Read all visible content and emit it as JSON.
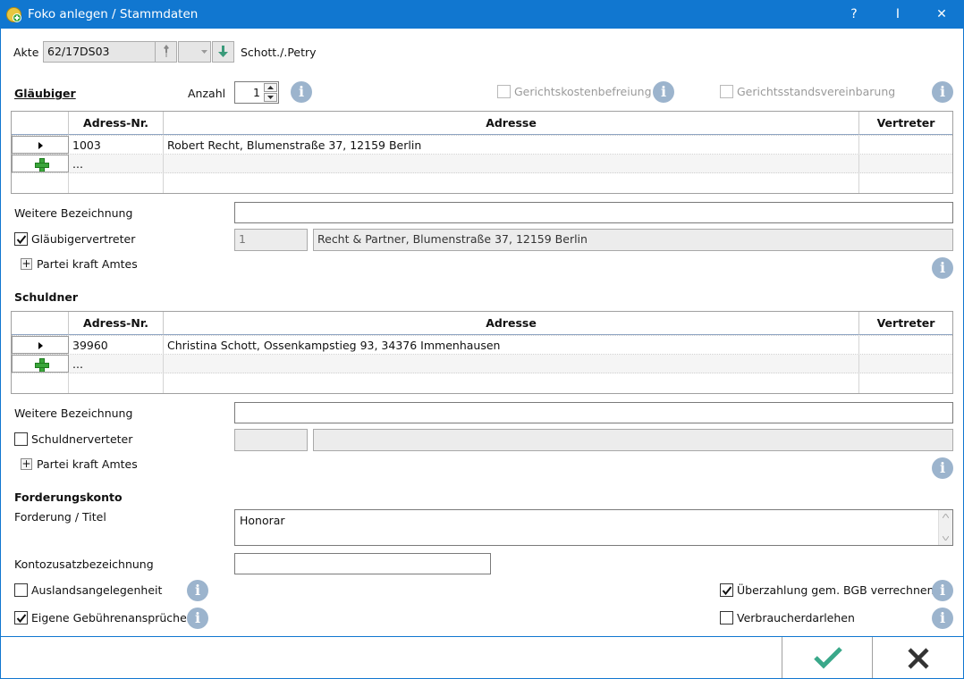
{
  "window": {
    "title": "Foko anlegen / Stammdaten",
    "help_label": "?",
    "pin_label": "I",
    "close_label": "✕"
  },
  "akte": {
    "label": "Akte",
    "value": "62/17DS03",
    "name": "Schott./.Petry"
  },
  "glaeubiger": {
    "title": "Gläubiger",
    "anzahl_label": "Anzahl",
    "anzahl_value": "1",
    "gerichtskosten_label": "Gerichtskostenbefreiung",
    "gerichtsstand_label": "Gerichtsstandsvereinbarung",
    "columns": [
      "Adress-Nr.",
      "Adresse",
      "Vertreter"
    ],
    "rows": [
      {
        "nr": "1003",
        "adresse": "Robert Recht,  Blumenstraße 37,  12159 Berlin",
        "vertreter": ""
      }
    ],
    "new_row_placeholder": "...",
    "weitere_label": "Weitere Bezeichnung",
    "weitere_value": "",
    "vertreter_label": "Gläubigervertreter",
    "vertreter_checked": true,
    "vertreter_nr": "1",
    "vertreter_adresse": "Recht & Partner,  Blumenstraße 37,  12159 Berlin",
    "partei_label": "Partei kraft Amtes"
  },
  "schuldner": {
    "title": "Schuldner",
    "columns": [
      "Adress-Nr.",
      "Adresse",
      "Vertreter"
    ],
    "rows": [
      {
        "nr": "39960",
        "adresse": "Christina Schott,  Ossenkampstieg 93,  34376 Immenhausen",
        "vertreter": ""
      }
    ],
    "new_row_placeholder": "...",
    "weitere_label": "Weitere Bezeichnung",
    "weitere_value": "",
    "vertreter_label": "Schuldnerverteter",
    "vertreter_checked": false,
    "vertreter_nr": "",
    "vertreter_adresse": "",
    "partei_label": "Partei kraft Amtes"
  },
  "forderung": {
    "title": "Forderungskonto",
    "titel_label": "Forderung / Titel",
    "titel_value": "Honorar",
    "konto_label": "Kontozusatzbezeichnung",
    "konto_value": "",
    "ausland_label": "Auslandsangelegenheit",
    "ausland_checked": false,
    "eigene_label": "Eigene Gebührenansprüche",
    "eigene_checked": true,
    "ueberzahlung_label": "Überzahlung gem. BGB verrechnen",
    "ueberzahlung_checked": true,
    "verbraucher_label": "Verbraucherdarlehen",
    "verbraucher_checked": false
  },
  "colors": {
    "accent": "#1177d0",
    "ok": "#3aa88a",
    "info": "#9cb4cd"
  },
  "icons": {
    "info": "i",
    "ok": "checkmark",
    "cancel": "x"
  }
}
